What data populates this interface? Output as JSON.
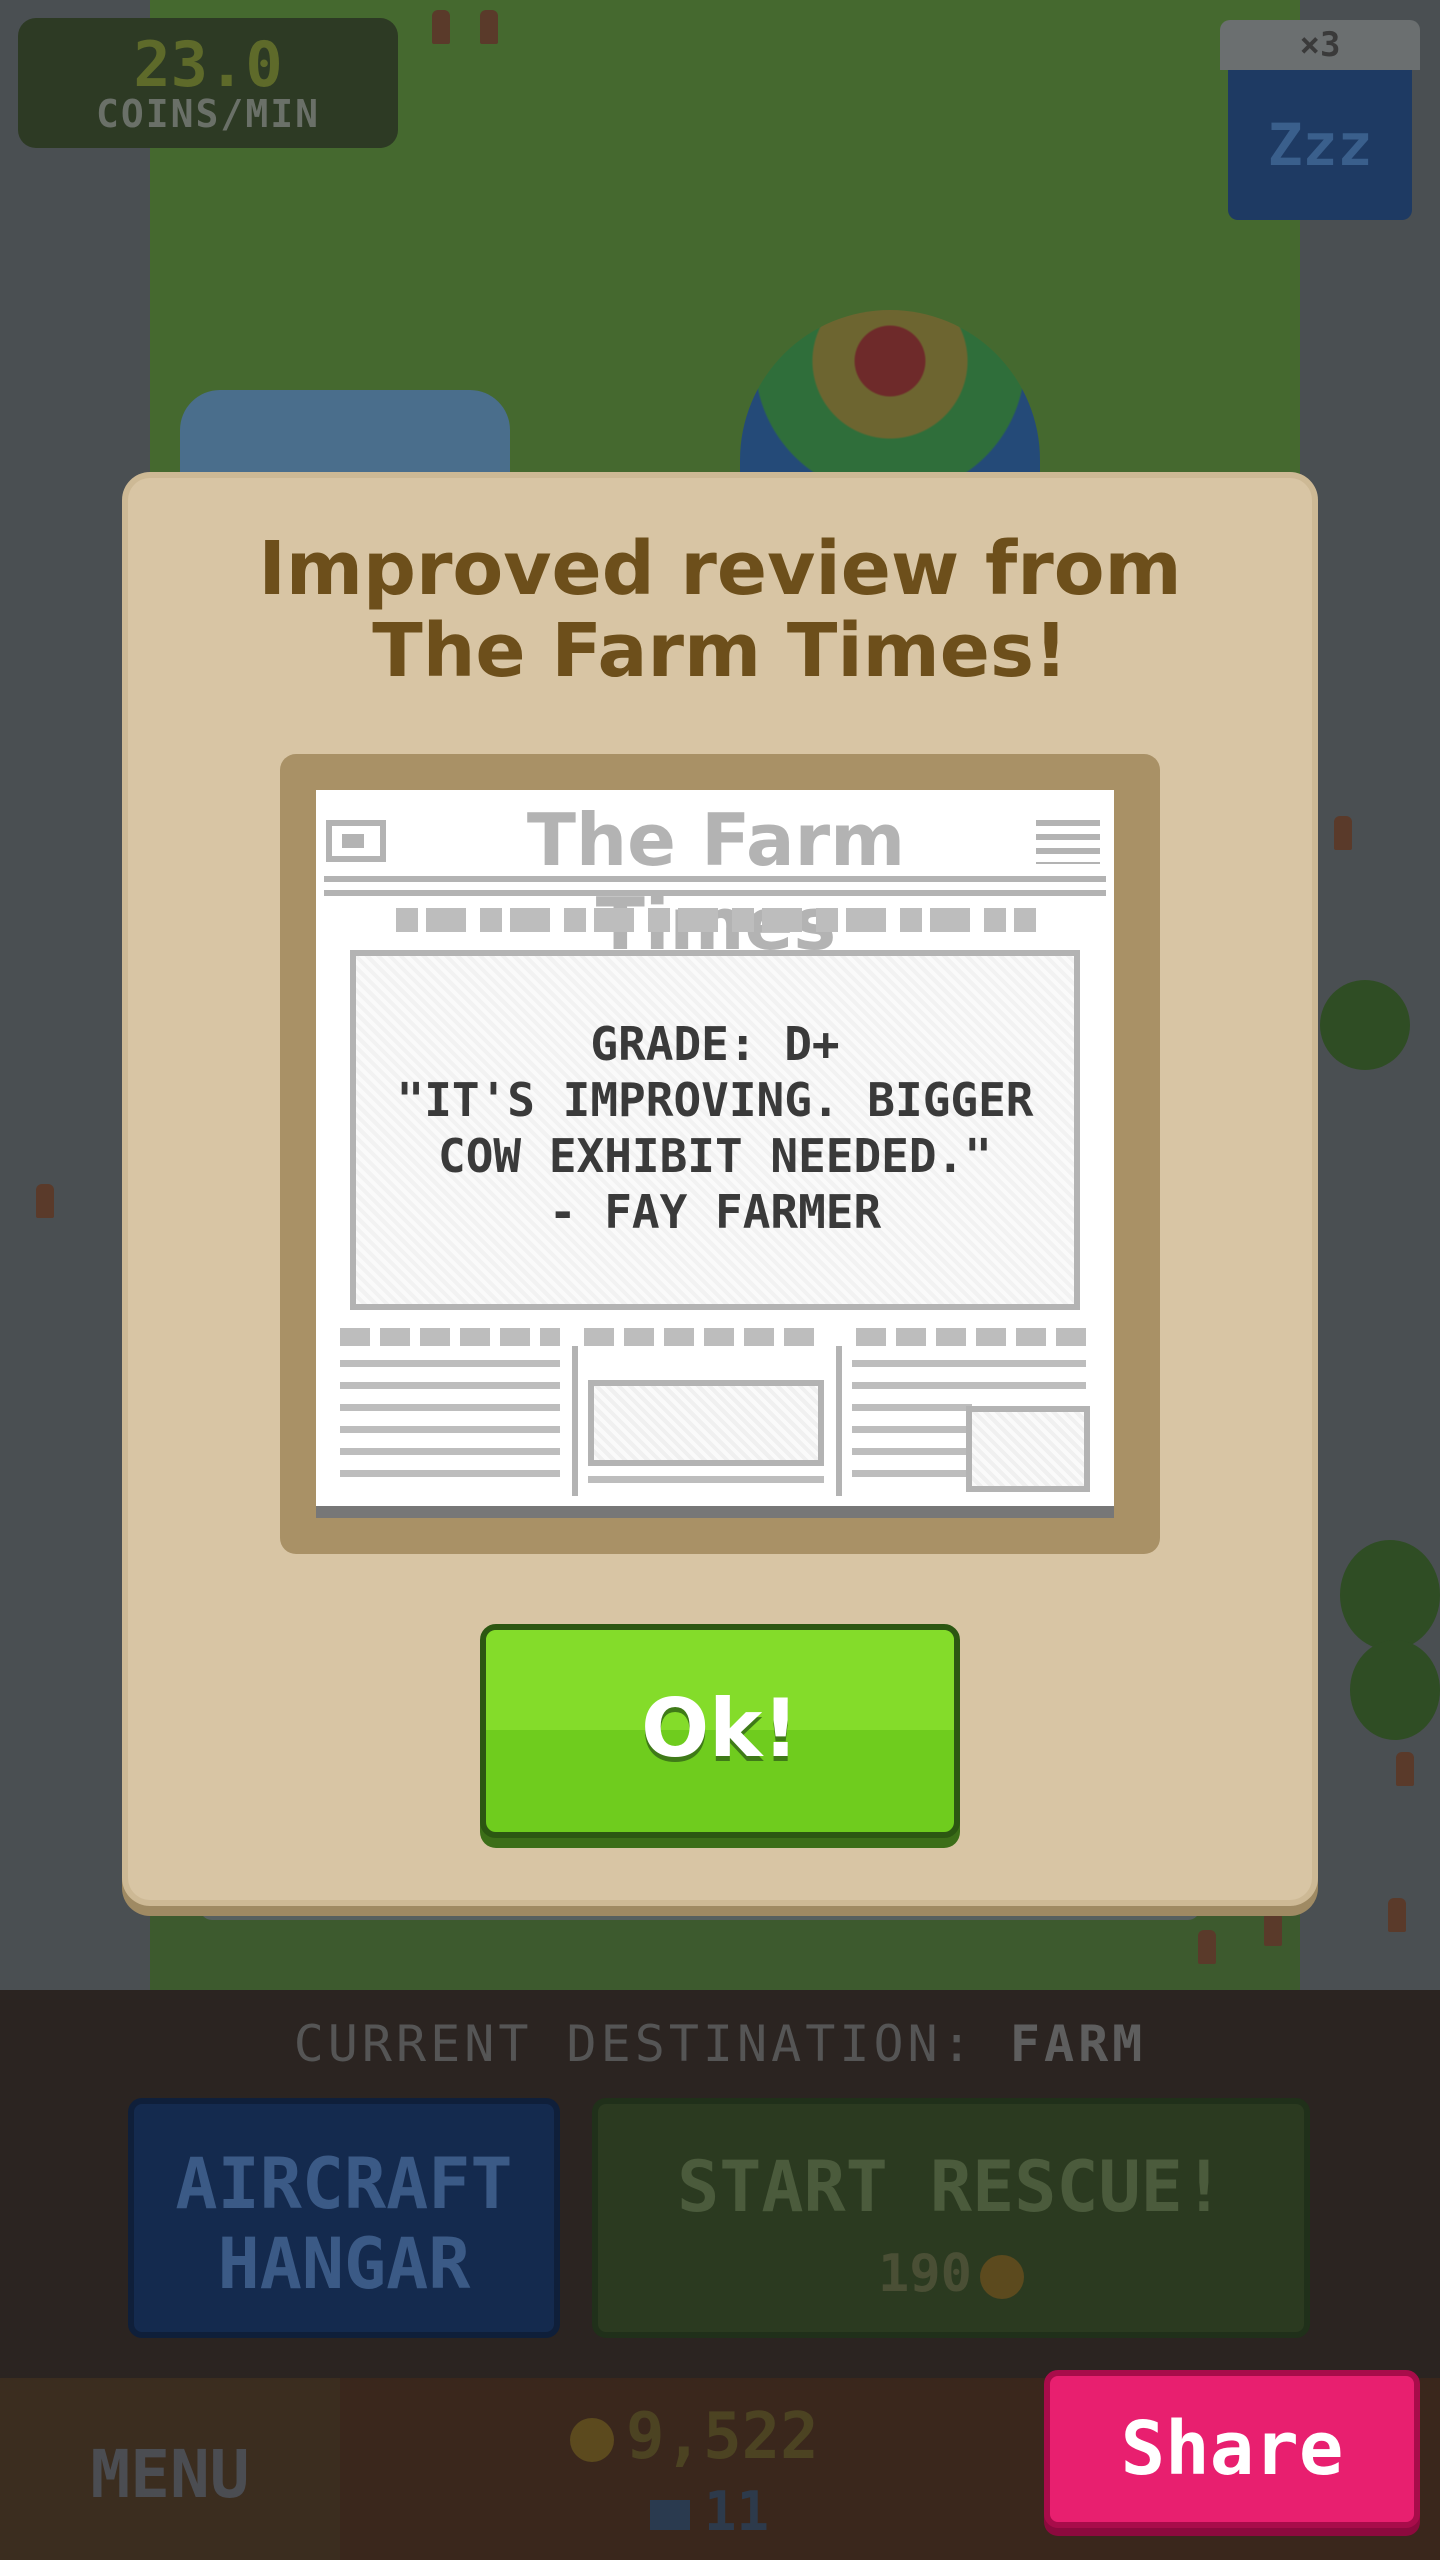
{
  "hud_top": {
    "coins_rate": "23.0",
    "coins_unit": "COINS/MIN",
    "sleep_multiplier": "×3",
    "sleep_label": "Zzz"
  },
  "dialog": {
    "title_line1": "Improved review from",
    "title_line2": "The Farm Times!",
    "newspaper": {
      "name": "The Farm Times",
      "grade_line": "GRADE: D+",
      "quote_line1": "\"IT'S IMPROVING. BIGGER",
      "quote_line2": "COW EXHIBIT NEEDED.\"",
      "author_line": "- FAY FARMER"
    },
    "ok_label": "Ok!"
  },
  "hud_bottom": {
    "destination_prefix": "CURRENT DESTINATION: ",
    "destination_value": "FARM",
    "hangar_label": "AIRCRAFT\nHANGAR",
    "rescue_label": "START RESCUE!",
    "rescue_cost": "190",
    "menu_label": "MENU",
    "coins_total": "9,522",
    "gems_total": "11",
    "share_label": "Share"
  },
  "colors": {
    "dialog_bg": "#d8c5a4",
    "title_text": "#6d4f1b",
    "ok_green": "#6fcc1e",
    "share_pink": "#e81f6f"
  },
  "icons": [
    "coin-icon",
    "gem-icon",
    "sleep-icon",
    "newspaper-icon"
  ]
}
